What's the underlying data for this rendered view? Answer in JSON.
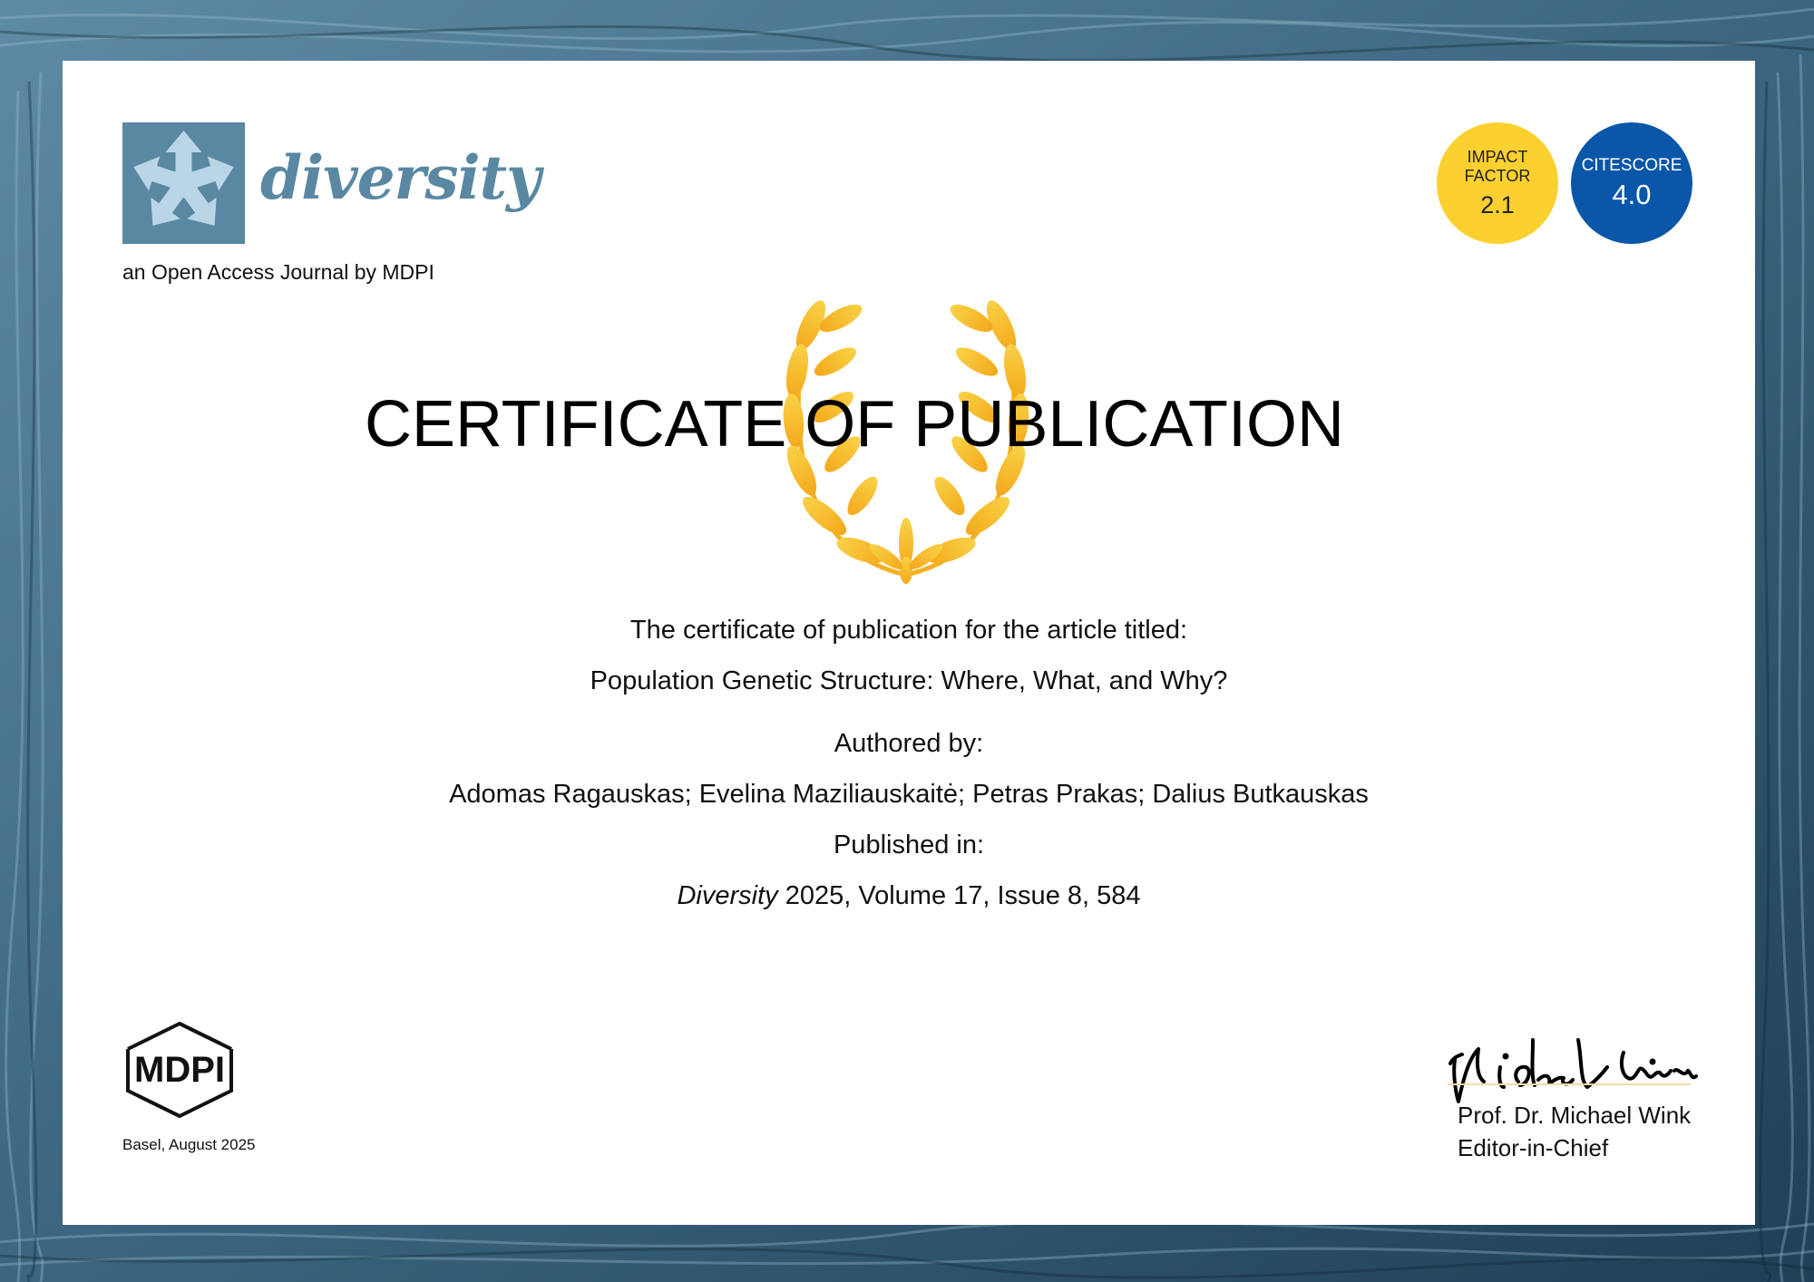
{
  "journal": {
    "name": "diversity",
    "tagline": "an Open Access Journal by MDPI"
  },
  "metrics": {
    "impact_label": "IMPACT FACTOR",
    "impact_line1": "IMPACT",
    "impact_line2": "FACTOR",
    "impact_value": "2.1",
    "citescore_label": "CITESCORE",
    "citescore_value": "4.0"
  },
  "certificate": {
    "title": "CERTIFICATE OF PUBLICATION",
    "intro": "The certificate of publication for the article titled:",
    "article_title": "Population Genetic Structure: Where, What, and Why?",
    "authored_by_label": "Authored by:",
    "authors": "Adomas Ragauskas; Evelina Maziliauskaitė; Petras Prakas; Dalius Butkauskas",
    "published_in_label": "Published in:",
    "journal_italic": "Diversity",
    "citation": "2025, Volume 17, Issue 8, 584"
  },
  "footer": {
    "publisher_logo": "MDPI",
    "place_date": "Basel, August 2025",
    "signer_name": "Prof. Dr. Michael Wink",
    "signer_role": "Editor-in-Chief"
  },
  "colors": {
    "journal_blue": "#5a88a2",
    "impact_yellow": "#fbd02f",
    "citescore_blue": "#0a56a8",
    "laurel_gold": "#f6b71c"
  },
  "icons": {
    "journal_logo": "diversity-star-arrows-icon",
    "laurel": "laurel-wreath-icon",
    "signature": "handwritten-signature"
  }
}
